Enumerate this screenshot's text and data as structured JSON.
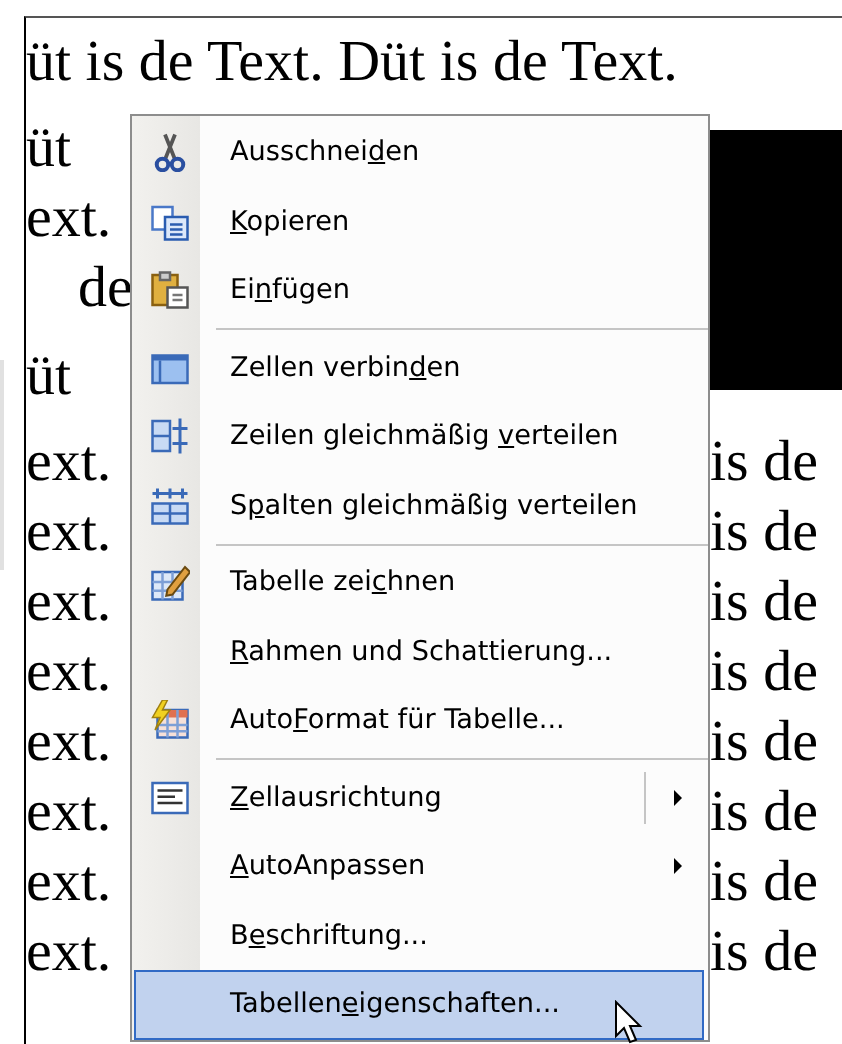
{
  "document": {
    "top_line": "üt is de Text. Düt is de Text.",
    "left_fragments": [
      "üt",
      "ext.",
      "de",
      "üt",
      "ext.",
      "ext.",
      "ext.",
      "ext.",
      "ext.",
      "ext.",
      "ext.",
      "ext."
    ],
    "right_fragments": [
      "is de",
      "is de",
      "is de",
      "is de",
      "is de",
      "is de",
      "is de",
      "is de"
    ]
  },
  "context_menu": {
    "items": [
      {
        "kind": "item",
        "label_before": "Ausschnei",
        "access_key": "d",
        "label_after": "en",
        "has_submenu": false,
        "split_button": false,
        "selected": false
      },
      {
        "kind": "item",
        "access_key": "K",
        "label_after": "opieren",
        "has_submenu": false,
        "split_button": false,
        "selected": false
      },
      {
        "kind": "item",
        "label_before": "Ei",
        "access_key": "n",
        "label_after": "fügen",
        "has_submenu": false,
        "split_button": false,
        "selected": false
      },
      {
        "kind": "separator"
      },
      {
        "kind": "item",
        "label_before": "Zellen verbin",
        "access_key": "d",
        "label_after": "en",
        "has_submenu": false,
        "split_button": false,
        "selected": false
      },
      {
        "kind": "item",
        "label_before": "Zeilen gleichmäßig ",
        "access_key": "v",
        "label_after": "erteilen",
        "has_submenu": false,
        "split_button": false,
        "selected": false
      },
      {
        "kind": "item",
        "label_before": "S",
        "access_key": "p",
        "label_after": "alten gleichmäßig verteilen",
        "has_submenu": false,
        "split_button": false,
        "selected": false
      },
      {
        "kind": "separator"
      },
      {
        "kind": "item",
        "label_before": "Tabelle zei",
        "access_key": "c",
        "label_after": "hnen",
        "has_submenu": false,
        "split_button": false,
        "selected": false
      },
      {
        "kind": "item",
        "access_key": "R",
        "label_after": "ahmen und Schattierung...",
        "has_submenu": false,
        "split_button": false,
        "selected": false
      },
      {
        "kind": "item",
        "label_before": "Auto",
        "access_key": "F",
        "label_after": "ormat für Tabelle...",
        "has_submenu": false,
        "split_button": false,
        "selected": false
      },
      {
        "kind": "separator"
      },
      {
        "kind": "item",
        "access_key": "Z",
        "label_after": "ellausrichtung",
        "has_submenu": true,
        "split_button": true,
        "selected": false
      },
      {
        "kind": "item",
        "access_key": "A",
        "label_after": "utoAnpassen",
        "has_submenu": true,
        "split_button": false,
        "selected": false
      },
      {
        "kind": "item",
        "label_before": "B",
        "access_key": "e",
        "label_after": "schriftung...",
        "has_submenu": false,
        "split_button": false,
        "selected": false
      },
      {
        "kind": "item",
        "label_before": "Tabellen",
        "access_key": "e",
        "label_after": "igenschaften...",
        "has_submenu": false,
        "split_button": false,
        "selected": true
      }
    ]
  }
}
